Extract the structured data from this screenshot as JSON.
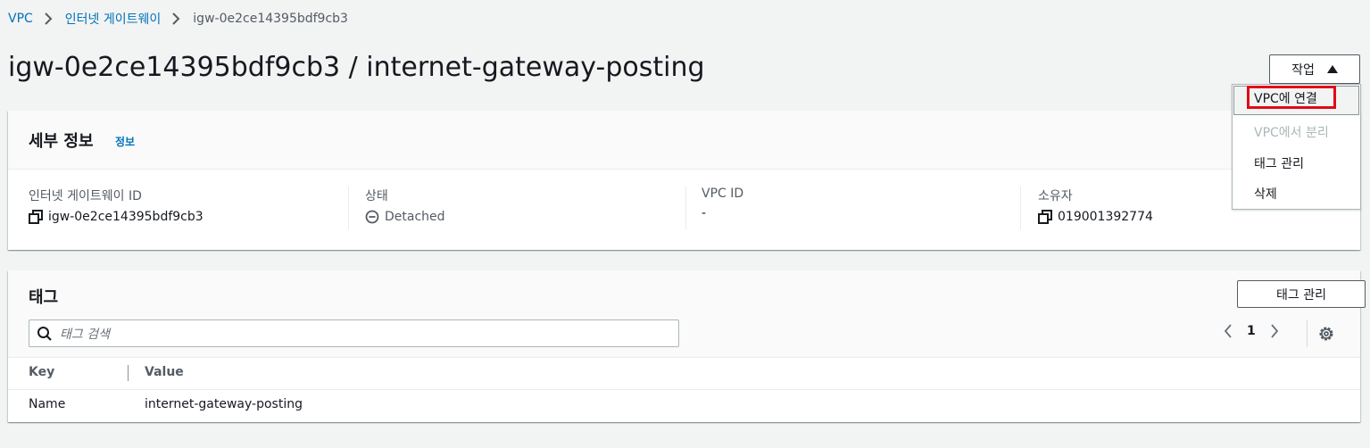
{
  "breadcrumb": {
    "items": [
      "VPC",
      "인터넷 게이트웨이"
    ],
    "current": "igw-0e2ce14395bdf9cb3"
  },
  "page_title": "igw-0e2ce14395bdf9cb3 / internet-gateway-posting",
  "actions": {
    "label": "작업",
    "menu": [
      "VPC에 연결",
      "VPC에서 분리",
      "태그 관리",
      "삭제"
    ]
  },
  "details": {
    "title": "세부 정보",
    "info_link": "정보",
    "fields": [
      {
        "label": "인터넷 게이트웨이 ID",
        "value": "igw-0e2ce14395bdf9cb3"
      },
      {
        "label": "상태",
        "value": "Detached"
      },
      {
        "label": "VPC ID",
        "value": "-"
      },
      {
        "label": "소유자",
        "value": "019001392774"
      }
    ]
  },
  "tags": {
    "title": "태그",
    "manage_button": "태그 관리",
    "search_placeholder": "태그 검색",
    "page": "1",
    "columns": [
      "Key",
      "Value"
    ],
    "rows": [
      {
        "key": "Name",
        "value": "internet-gateway-posting"
      }
    ]
  },
  "colors": {
    "link": "#0073bb",
    "highlight_box": "#e10a17",
    "background": "#f2f3f3"
  }
}
